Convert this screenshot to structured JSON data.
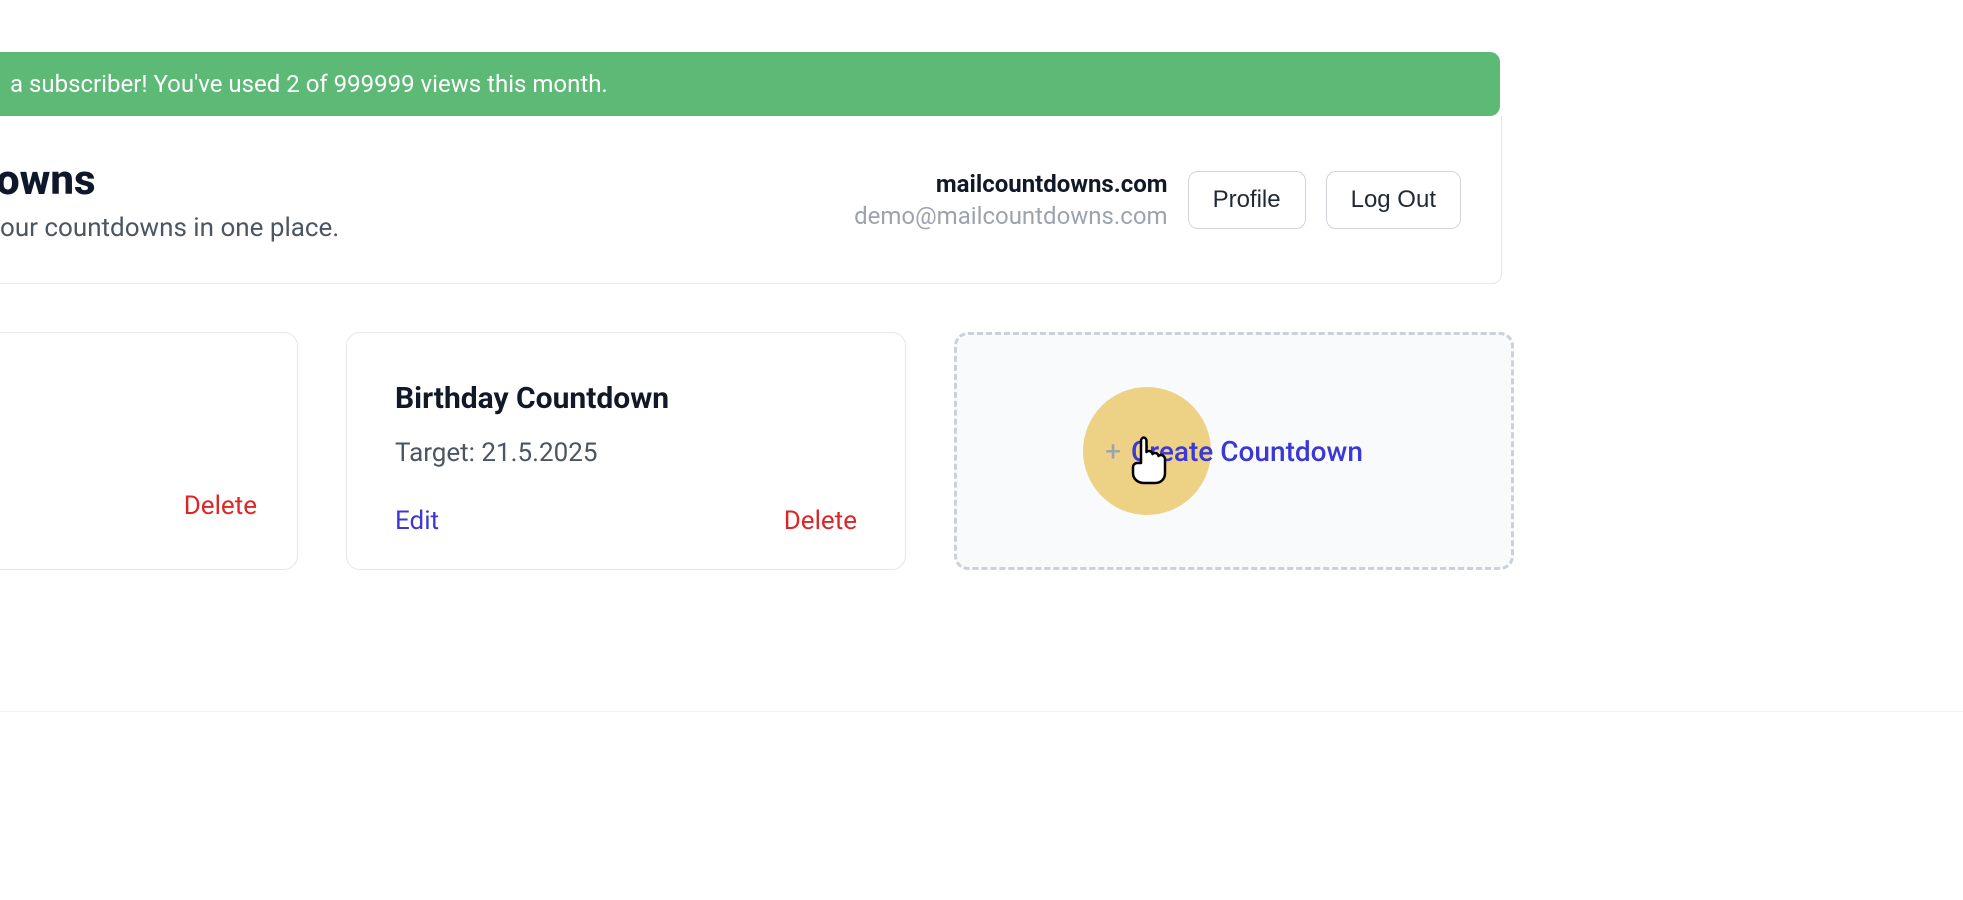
{
  "banner": {
    "text": "a subscriber! You've used 2 of 999999 views this month."
  },
  "header": {
    "title_partial": "owns",
    "subtitle_partial": "our countdowns in one place.",
    "account_name": "mailcountdowns.com",
    "account_email": "demo@mailcountdowns.com",
    "profile_label": "Profile",
    "logout_label": "Log Out"
  },
  "cards": {
    "truncated": {
      "delete_label": "Delete"
    },
    "item1": {
      "title": "Birthday Countdown",
      "target": "Target: 21.5.2025",
      "edit_label": "Edit",
      "delete_label": "Delete"
    }
  },
  "create": {
    "plus": "+",
    "label": "Create Countdown"
  }
}
